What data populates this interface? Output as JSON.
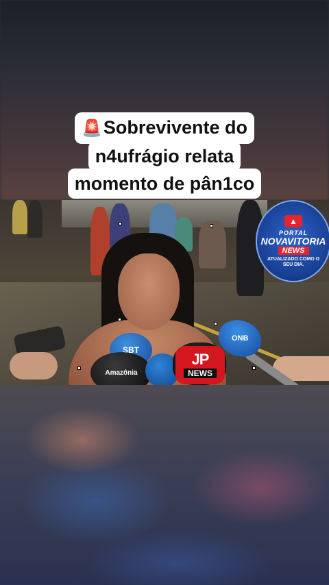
{
  "caption": {
    "icon": "rotating-light-icon",
    "icon_glyph": "🚨",
    "line1": "Sobrevivente do",
    "line2": "n4ufrágio relata",
    "line3": "momento de pân1co"
  },
  "video": {
    "mics": {
      "blue_top": "SBT",
      "black": "Amazônia",
      "jp_logo": "JP",
      "jp_news": "NEWS",
      "right": "ONB"
    }
  },
  "channel_logo": {
    "line1": "PORTAL",
    "line2": "NOVAVITORIA",
    "line3": "NEWS",
    "tagline": "ATUALIZADO COMO O SEU DIA."
  },
  "colors": {
    "caption_bg": "#ffffff",
    "caption_text": "#111111",
    "logo_blue": "#173e92",
    "logo_red": "#e5242c",
    "jp_red": "#d4161e"
  }
}
